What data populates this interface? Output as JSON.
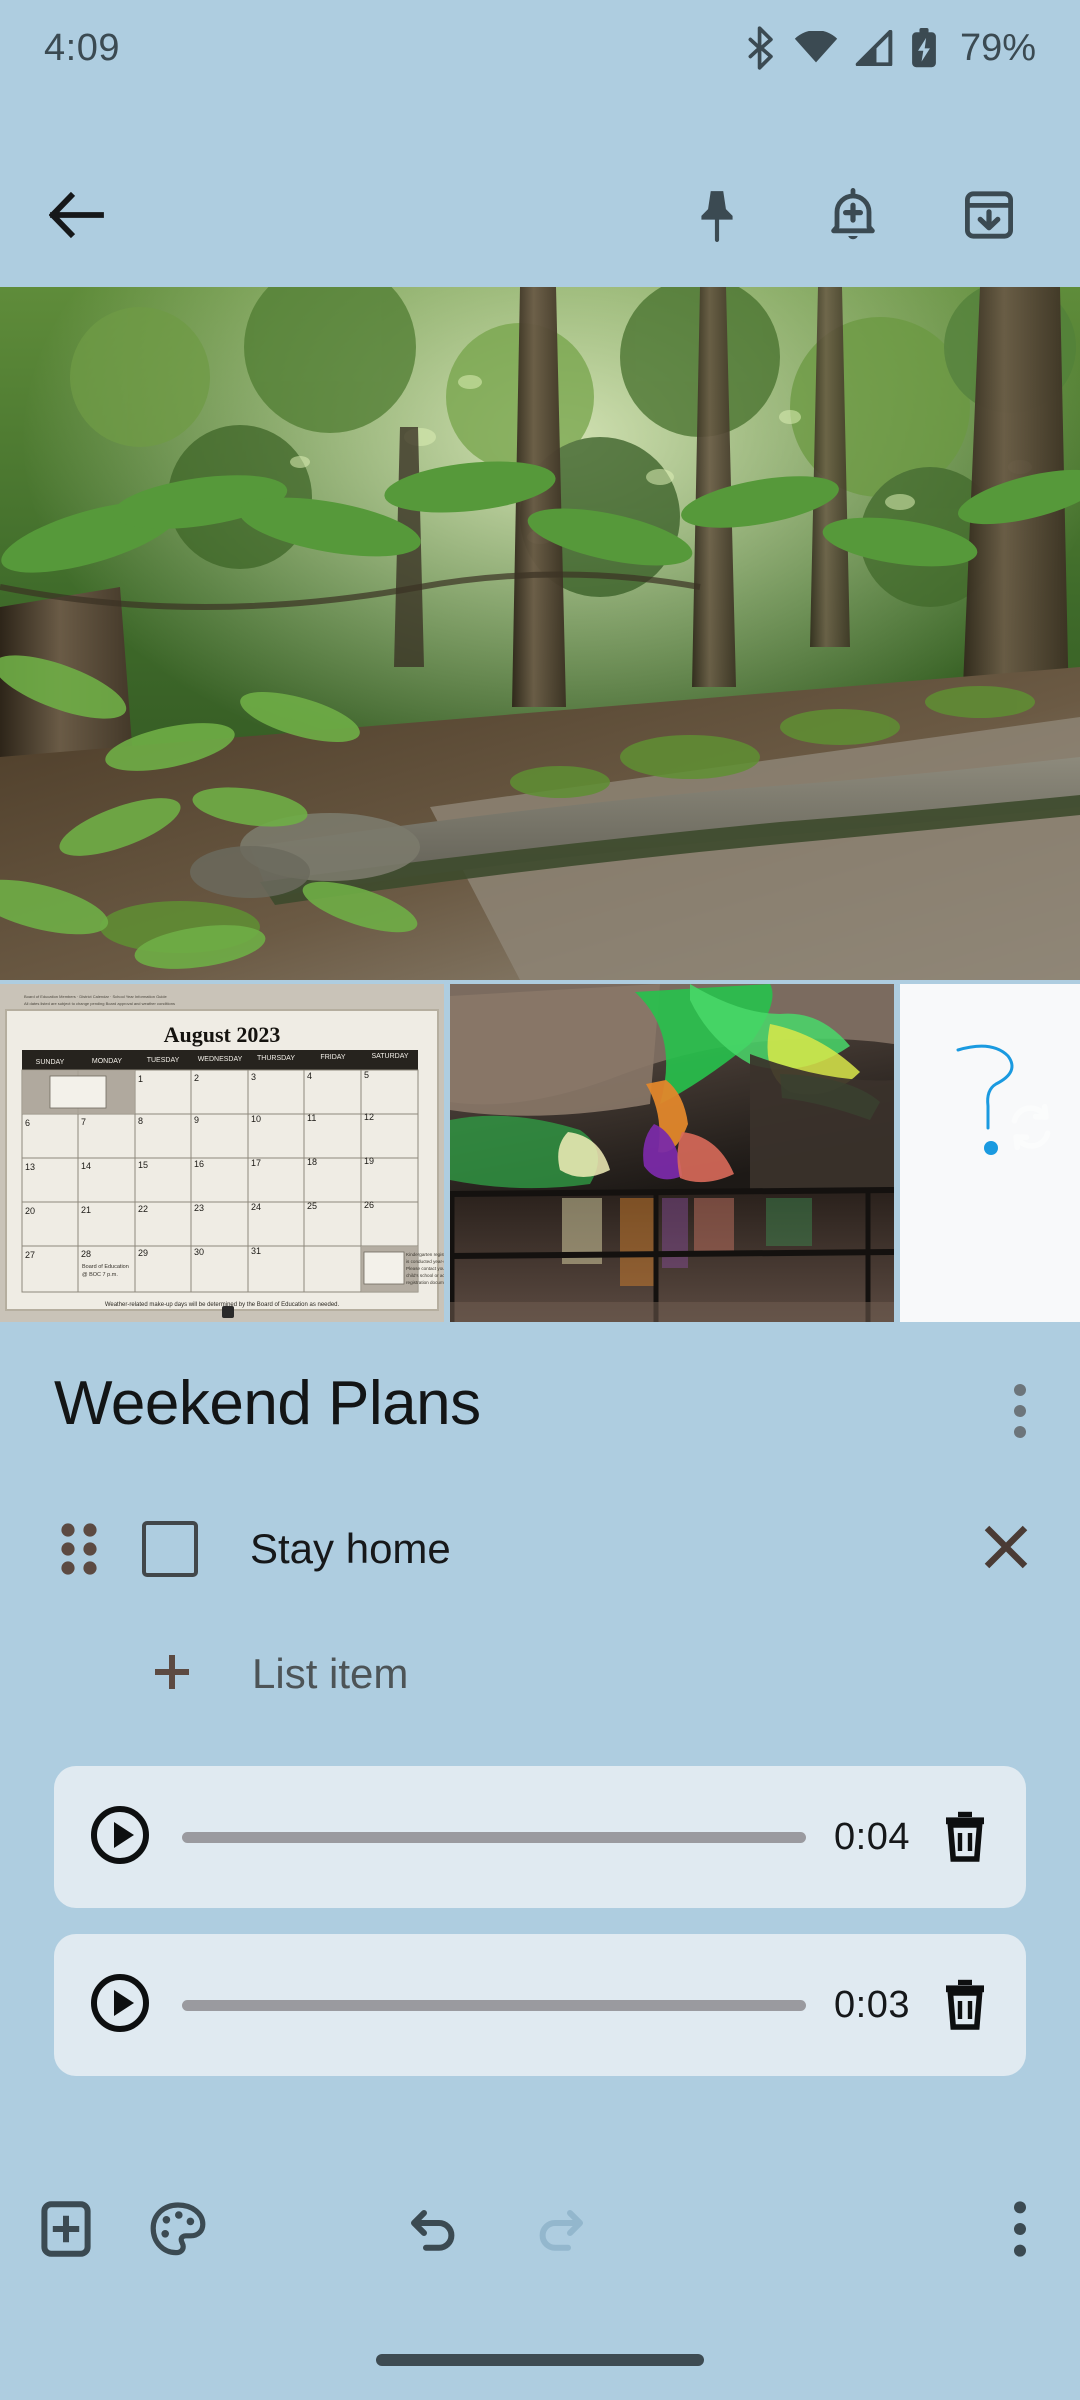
{
  "status_bar": {
    "time": "4:09",
    "battery_percent": "79%",
    "icons": [
      "bluetooth-icon",
      "wifi-icon",
      "cellular-signal-icon",
      "battery-charging-icon"
    ]
  },
  "app_bar": {
    "back_label": "back-arrow-icon",
    "actions": [
      {
        "name": "pin-icon",
        "label": "Pin"
      },
      {
        "name": "add-reminder-icon",
        "label": "Remind me"
      },
      {
        "name": "archive-icon",
        "label": "Archive"
      }
    ]
  },
  "media": {
    "hero": {
      "name": "forest-trail-photo",
      "alt": "Sunlit green forest with mossy rock ledge and dirt trail"
    },
    "thumbnails": [
      {
        "name": "calendar-photo-thumbnail",
        "alt": "Photo of a paper wall calendar",
        "caption": "August 2023",
        "weekdays": [
          "SUNDAY",
          "MONDAY",
          "TUESDAY",
          "WEDNESDAY",
          "THURSDAY",
          "FRIDAY",
          "SATURDAY"
        ],
        "footer_note": "Weather-related make-up days will be determined by the Board of Education as needed.",
        "event_note": "Board of Education @ BOC 7 p.m."
      },
      {
        "name": "cave-photo-thumbnail",
        "alt": "Colorfully lit cave interior with water reflection and railing"
      },
      {
        "name": "drawing-thumbnail",
        "alt": "Hand drawn blue question mark on white background",
        "badge": "sync-icon"
      }
    ]
  },
  "note": {
    "title": "Weekend Plans",
    "overflow_menu": "note-options-icon",
    "checklist": [
      {
        "label": "Stay home",
        "checked": false,
        "drag_handle": "drag-handle-icon",
        "delete": "close-icon"
      }
    ],
    "add_item_label": "List item"
  },
  "audio_recordings": [
    {
      "play": "play-icon",
      "duration": "0:04",
      "delete": "trash-icon",
      "progress": 0
    },
    {
      "play": "play-icon",
      "duration": "0:03",
      "delete": "trash-icon",
      "progress": 0
    }
  ],
  "toolbar": {
    "add_label": "add-box-icon",
    "palette_label": "color-palette-icon",
    "undo_label": "undo-icon",
    "redo_label": "redo-icon",
    "more_label": "more-options-icon",
    "redo_enabled": false
  },
  "colors": {
    "background": "#aecde0",
    "card": "#e0eaf1",
    "icon": "#3b4a52",
    "text": "#16181a",
    "muted": "#4d5457",
    "track": "#9a9a9f",
    "disabled": "#93b7cd"
  }
}
